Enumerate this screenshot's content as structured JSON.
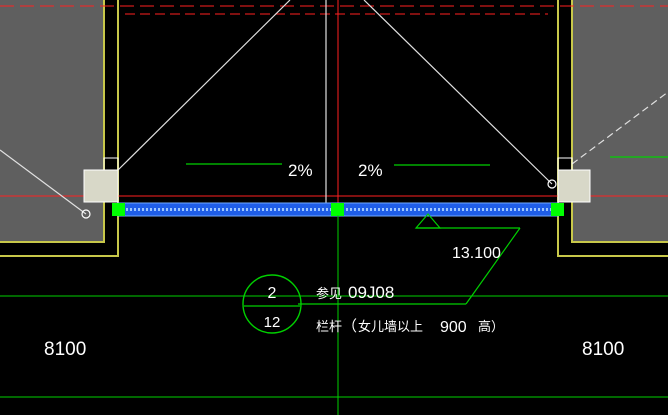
{
  "drawing": {
    "slope_left": "2%",
    "slope_right": "2%",
    "elevation": "13.100",
    "detail_callout": {
      "number": "2",
      "sheet": "12"
    },
    "reference_label": "参见",
    "reference_code": "09J08",
    "note_prefix": "栏杆",
    "note_paren_open": "（",
    "note_text": "女儿墙以上",
    "note_value": "900",
    "note_suffix": "高）",
    "dimension_left": "8100",
    "dimension_right": "8100"
  },
  "colors": {
    "background": "#000000",
    "wall_fill": "#5f5f5f",
    "wall_outline": "#c8c84a",
    "axis_red": "#ff2020",
    "green": "#00d000",
    "blue_beam": "#2f7bff",
    "grip_green": "#00ff00",
    "white": "#ffffff",
    "column_fill": "#d8d8c8"
  }
}
